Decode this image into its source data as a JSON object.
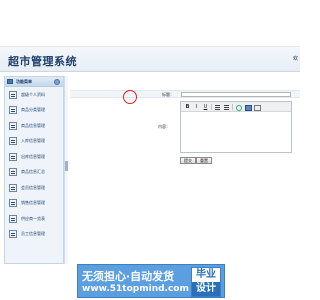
{
  "header": {
    "title": "超市管理系统",
    "right_text": "欢"
  },
  "sidebar": {
    "head_label": "功能菜单",
    "items": [
      {
        "label": "超级个人资料"
      },
      {
        "label": "商品分类管理"
      },
      {
        "label": "商品信息管理"
      },
      {
        "label": "入库信息管理"
      },
      {
        "label": "出库信息管理"
      },
      {
        "label": "商品信息汇总"
      },
      {
        "label": "会员信息管理"
      },
      {
        "label": "销售信息管理"
      },
      {
        "label": "供应商一览表"
      },
      {
        "label": "员工信息管理"
      }
    ]
  },
  "form": {
    "title_label": "标题：",
    "title_value": "",
    "content_label": "内容：",
    "content_value": "",
    "toolbar": [
      "B",
      "I",
      "U"
    ],
    "submit_label": "提交",
    "reset_label": "重置"
  },
  "watermark": {
    "line1": "无须担心·自动发货",
    "line2": "www.51topmind.com",
    "badge_top": "毕业",
    "badge_bottom": "设计"
  },
  "colors": {
    "brand_blue": "#1f3f6b",
    "annotation_red": "#dd2222",
    "watermark_blue": "#5b9fe0"
  }
}
